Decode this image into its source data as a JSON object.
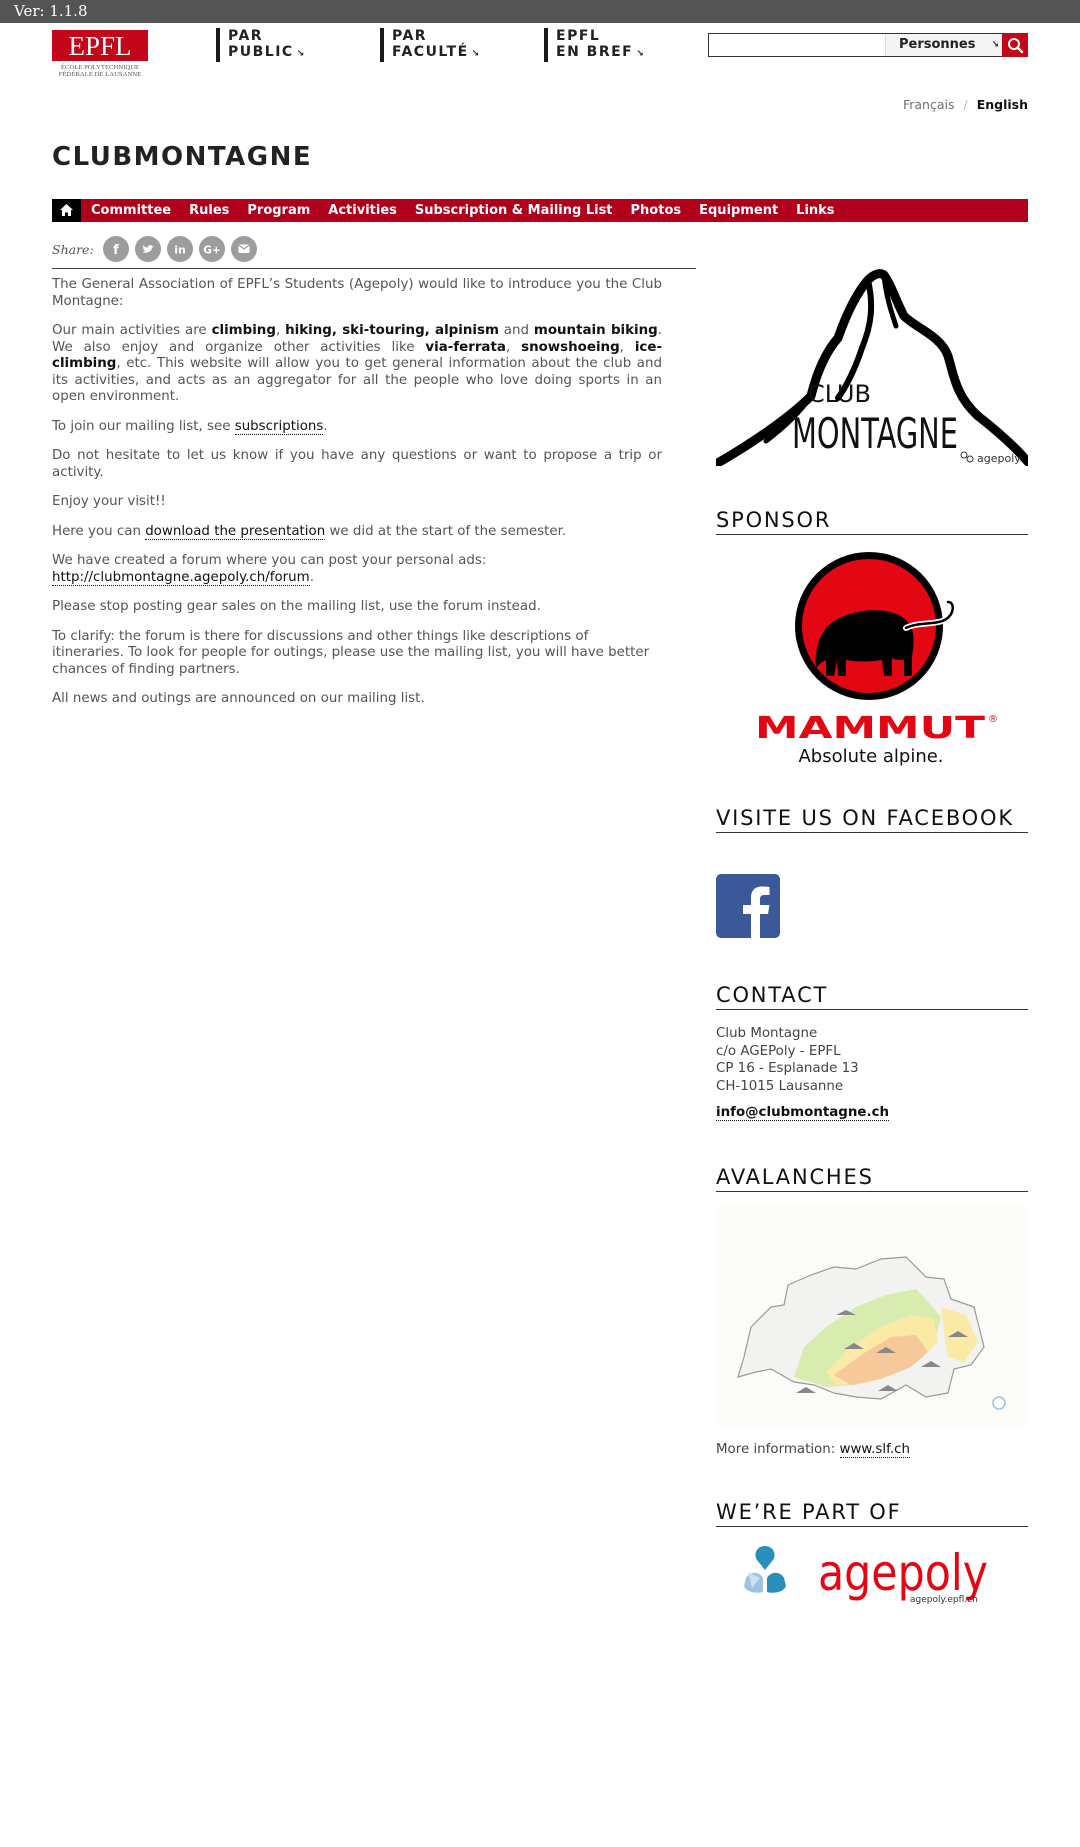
{
  "version_label": "Ver: 1.1.8",
  "header": {
    "logo_text": "EPFL",
    "logo_line1": "ÉCOLE POLYTECHNIQUE",
    "logo_line2": "FÉDÉRALE DE LAUSANNE",
    "nav": [
      {
        "line1": "PAR",
        "line2": "PUBLIC"
      },
      {
        "line1": "PAR",
        "line2": "FACULTÉ"
      },
      {
        "line1": "EPFL",
        "line2": "EN BREF"
      }
    ],
    "search": {
      "value": "",
      "placeholder": "",
      "select_value": "Personnes"
    }
  },
  "languages": {
    "fr": "Français",
    "sep": "/",
    "en": "English"
  },
  "site_title": "CLUBMONTAGNE",
  "menu": [
    "Committee",
    "Rules",
    "Program",
    "Activities",
    "Subscription & Mailing List",
    "Photos",
    "Equipment",
    "Links"
  ],
  "share": {
    "label": "Share:",
    "icons": [
      "facebook-icon",
      "twitter-icon",
      "linkedin-icon",
      "google-plus-icon",
      "email-icon"
    ]
  },
  "content": {
    "p1": "The General Association of EPFL’s Students (Agepoly) would like to introduce you the Club Montagne:",
    "p2": {
      "t1": "Our main activities are ",
      "b1": "climbing",
      "t2": ", ",
      "b2": "hiking, ski-touring, alpinism",
      "t3": " and ",
      "b3": "mountain biking",
      "t4": ". We also enjoy and organize other activities like ",
      "b4": "via-ferrata",
      "t5": ", ",
      "b5": "snowshoeing",
      "t6": ", ",
      "b6": "ice-climbing",
      "t7": ", etc. This website will allow you to get general information about the club and its activities, and acts as an aggregator for all the people who love doing sports in an open environment."
    },
    "p3": {
      "text": "To join our mailing list, see ",
      "link": "subscriptions",
      "end": "."
    },
    "p4": "Do not hesitate to let us know if you have any questions or want to propose a trip or activity.",
    "p5": "Enjoy your visit!!",
    "p6": {
      "text": "Here you can ",
      "link": "download the presentation",
      "end": " we did at the start of the semester."
    },
    "p7": {
      "text": "We have created a forum where you can post your personal ads: ",
      "link": "http://clubmontagne.agepoly.ch/forum",
      "end": "."
    },
    "p8": "Please stop posting gear sales on the mailing list, use the forum instead.",
    "p9": "To clarify: the forum is there for discussions and other things like descriptions of itineraries. To look for people for outings, please use the mailing list, you will have better chances of finding partners.",
    "p10": "All news and outings are announced on our mailing list."
  },
  "sidebar": {
    "club_logo": {
      "line1": "CLUB",
      "line2": "MONTAGNE",
      "small": "agepoly"
    },
    "sponsor_heading": "SPONSOR",
    "sponsor": {
      "brand": "MAMMUT",
      "reg": "®",
      "tagline": "Absolute alpine."
    },
    "facebook_heading": "VISITE US ON FACEBOOK",
    "contact_heading": "CONTACT",
    "contact_lines": [
      "Club Montagne",
      "c/o AGEPoly - EPFL",
      "CP 16 - Esplanade 13",
      "CH-1015 Lausanne"
    ],
    "contact_email": "info@clubmontagne.ch",
    "avalanches_heading": "AVALANCHES",
    "more_info_text": "More information: ",
    "more_info_link": "www.slf.ch",
    "partof_heading": "WE’RE PART OF",
    "agepoly": {
      "word": "agepoly",
      "url": "agepoly.epfl.ch"
    }
  },
  "colors": {
    "accent_red": "#b0001c",
    "epfl_red": "#c4061b",
    "version_bar": "#545454"
  }
}
